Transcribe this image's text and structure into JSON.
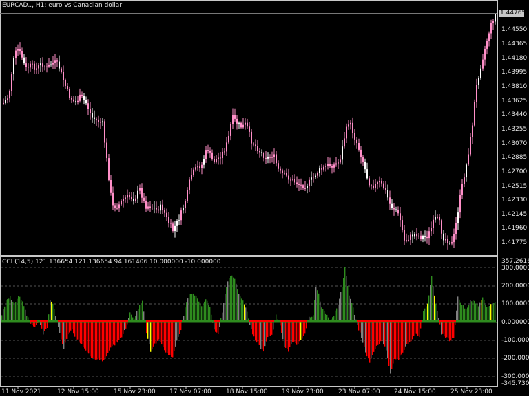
{
  "header": {
    "symbol_title": "EURCAD.., H1:  euro vs Canadian dollar"
  },
  "price_axis": {
    "ticks": [
      "1.44550",
      "1.44365",
      "1.44180",
      "1.43995",
      "1.43810",
      "1.43625",
      "1.43440",
      "1.43255",
      "1.43070",
      "1.42885",
      "1.42700",
      "1.42515",
      "1.42330",
      "1.42145",
      "1.41960",
      "1.41775"
    ],
    "current_price": "1.44765"
  },
  "indicator": {
    "title": "CCI (14,5) 121.136654 121.136654 94.161406 10.000000 -10.000000",
    "axis_ticks": [
      "357.261675",
      "300.000000",
      "200.000000",
      "100.000000",
      "0.000000",
      "-100.000000",
      "-200.000000",
      "-300.000000",
      "-345.730144"
    ]
  },
  "time_axis": {
    "labels": [
      "11 Nov 2021",
      "12 Nov 15:00",
      "15 Nov 23:00",
      "17 Nov 07:00",
      "18 Nov 15:00",
      "19 Nov 23:00",
      "23 Nov 07:00",
      "24 Nov 15:00",
      "25 Nov 23:00"
    ]
  },
  "colors": {
    "background": "#000000",
    "candle": "#ff8fc8",
    "candle_alt": "#ffffff",
    "cci_up": "#2e8b1e",
    "cci_down": "#ff0000",
    "cci_neutral": "#808080",
    "cci_cross": "#ffff00",
    "grid": "#3a3a3a"
  }
}
